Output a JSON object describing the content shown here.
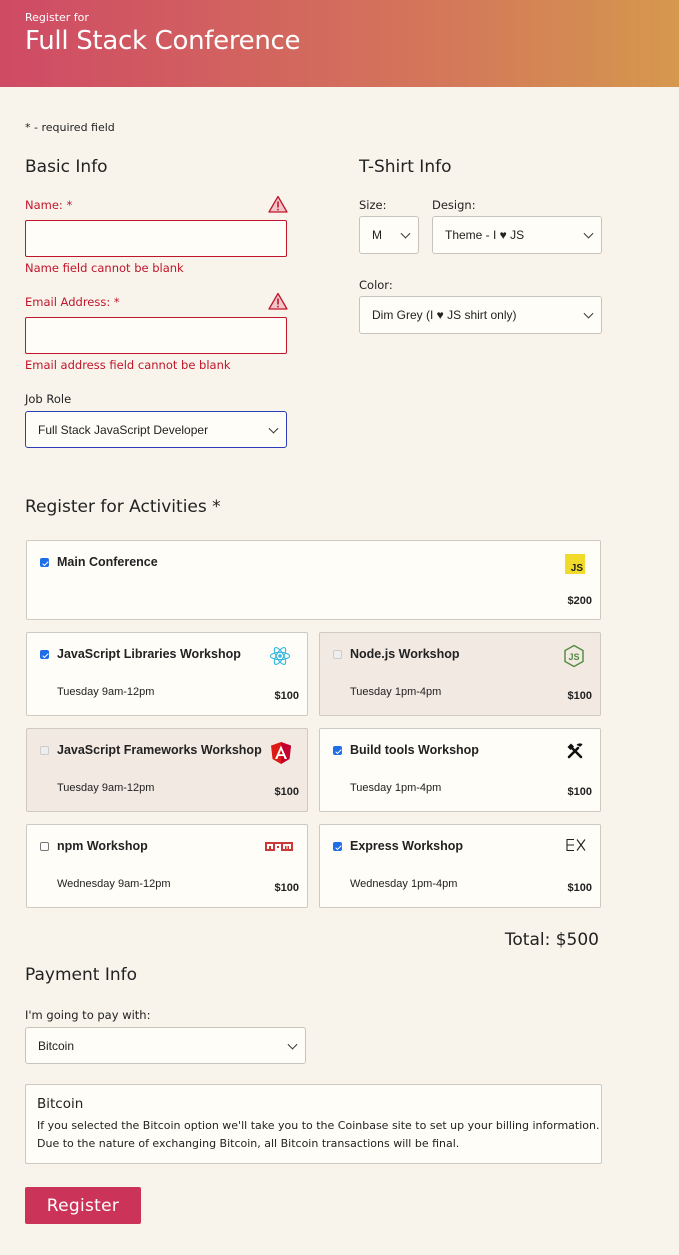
{
  "header": {
    "subtitle": "Register for",
    "title": "Full Stack Conference"
  },
  "required_note": "* - required field",
  "basic_info": {
    "heading": "Basic Info",
    "name_label": "Name: *",
    "name_value": "",
    "name_error": "Name field cannot be blank",
    "email_label": "Email Address: *",
    "email_value": "",
    "email_error": "Email address field cannot be blank",
    "job_role_label": "Job Role",
    "job_role_value": "Full Stack JavaScript Developer"
  },
  "tshirt": {
    "heading": "T-Shirt Info",
    "size_label": "Size:",
    "size_value": "M",
    "design_label": "Design:",
    "design_value": "Theme - I ♥ JS",
    "color_label": "Color:",
    "color_value": "Dim Grey (I ♥ JS shirt only)"
  },
  "activities": {
    "heading": "Register for Activities *",
    "items": [
      {
        "name": "Main Conference",
        "time": "",
        "cost": "$200",
        "checked": true,
        "disabled": false,
        "icon": "js-icon"
      },
      {
        "name": "JavaScript Libraries Workshop",
        "time": "Tuesday 9am-12pm",
        "cost": "$100",
        "checked": true,
        "disabled": false,
        "icon": "react-icon"
      },
      {
        "name": "Node.js Workshop",
        "time": "Tuesday 1pm-4pm",
        "cost": "$100",
        "checked": false,
        "disabled": true,
        "icon": "nodejs-icon"
      },
      {
        "name": "JavaScript Frameworks Workshop",
        "time": "Tuesday 9am-12pm",
        "cost": "$100",
        "checked": false,
        "disabled": true,
        "icon": "angular-icon"
      },
      {
        "name": "Build tools Workshop",
        "time": "Tuesday 1pm-4pm",
        "cost": "$100",
        "checked": true,
        "disabled": false,
        "icon": "tools-icon"
      },
      {
        "name": "npm Workshop",
        "time": "Wednesday 9am-12pm",
        "cost": "$100",
        "checked": false,
        "disabled": false,
        "icon": "npm-icon"
      },
      {
        "name": "Express Workshop",
        "time": "Wednesday 1pm-4pm",
        "cost": "$100",
        "checked": true,
        "disabled": false,
        "icon": "express-icon"
      }
    ],
    "total": "Total: $500"
  },
  "payment": {
    "heading": "Payment Info",
    "method_label": "I'm going to pay with:",
    "method_value": "Bitcoin",
    "info_title": "Bitcoin",
    "info_text": "If you selected the Bitcoin option we'll take you to the Coinbase site to set up your billing information. Due to the nature of exchanging Bitcoin, all Bitcoin transactions will be final."
  },
  "register_label": "Register",
  "colors": {
    "header_start": "#cf4a65",
    "header_end": "#d5984d",
    "error": "#c0152a",
    "button": "#cc3358",
    "checkbox": "#1e6ee8"
  }
}
